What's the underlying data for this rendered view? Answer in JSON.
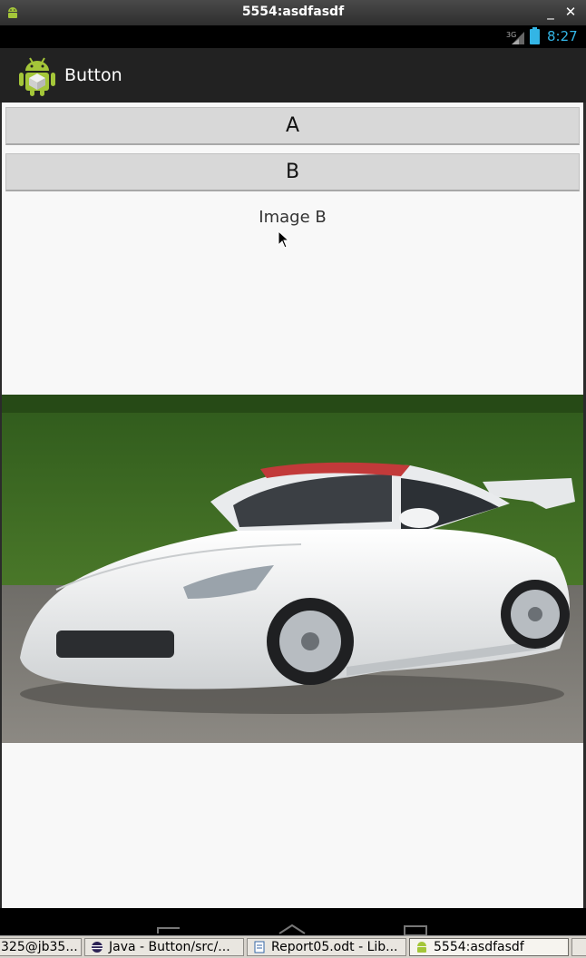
{
  "window": {
    "title": "5554:asdfasdf"
  },
  "statusbar": {
    "network": "3G",
    "time": "8:27"
  },
  "actionbar": {
    "title": "Button"
  },
  "content": {
    "button_a": "A",
    "button_b": "B",
    "image_label": "Image B",
    "image_subject": "car-photo"
  },
  "taskbar": {
    "items": [
      {
        "label": "325@jb35..."
      },
      {
        "label": "Java - Button/src/..."
      },
      {
        "label": "Report05.odt - Lib..."
      },
      {
        "label": "5554:asdfasdf"
      }
    ]
  },
  "colors": {
    "status_accent": "#33b5e5",
    "android_green": "#a4c639"
  }
}
